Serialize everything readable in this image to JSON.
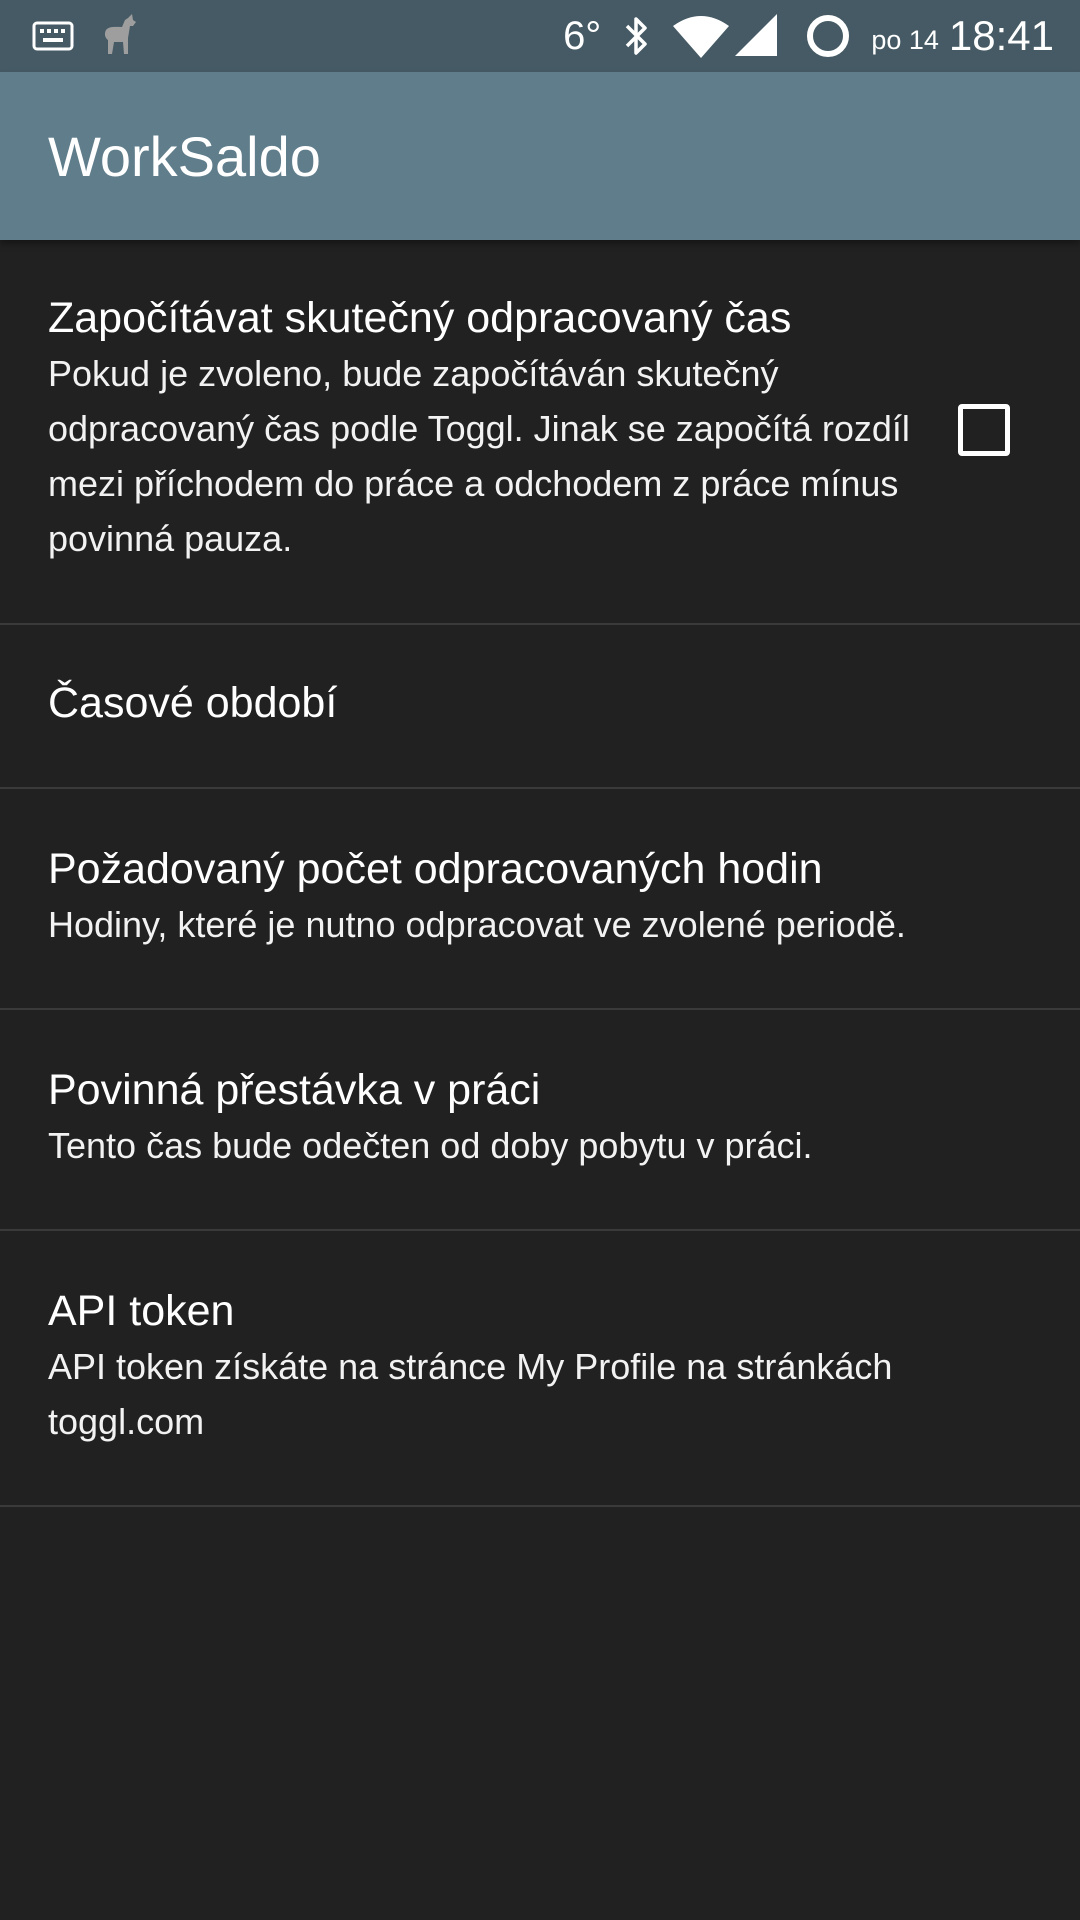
{
  "status_bar": {
    "icons_left": [
      "keyboard-icon",
      "android-icon"
    ],
    "temperature": "6°",
    "icons_right": [
      "bluetooth-icon",
      "wifi-icon",
      "cell-signal-icon",
      "ring-icon"
    ],
    "date": "po 14",
    "time": "18:41"
  },
  "app_bar": {
    "title": "WorkSaldo"
  },
  "preferences": [
    {
      "title": "Započítávat skutečný odpracovaný čas",
      "summary": "Pokud je zvoleno, bude započítáván skutečný odpracovaný čas podle Toggl. Jinak se započítá rozdíl mezi příchodem do práce a odchodem z práce mínus povinná pauza.",
      "checked": false
    },
    {
      "title": "Časové období"
    },
    {
      "title": "Požadovaný počet odpracovaných hodin",
      "summary": "Hodiny, které je nutno odpracovat ve zvolené periodě."
    },
    {
      "title": "Povinná přestávka v práci",
      "summary": "Tento čas bude odečten od doby pobytu v práci."
    },
    {
      "title": "API token",
      "summary": "API token získáte na stránce My Profile na stránkách toggl.com"
    }
  ],
  "colors": {
    "status_bar": "#455a64",
    "app_bar": "#607d8b",
    "background": "#212121",
    "divider": "#3a3a3a"
  }
}
